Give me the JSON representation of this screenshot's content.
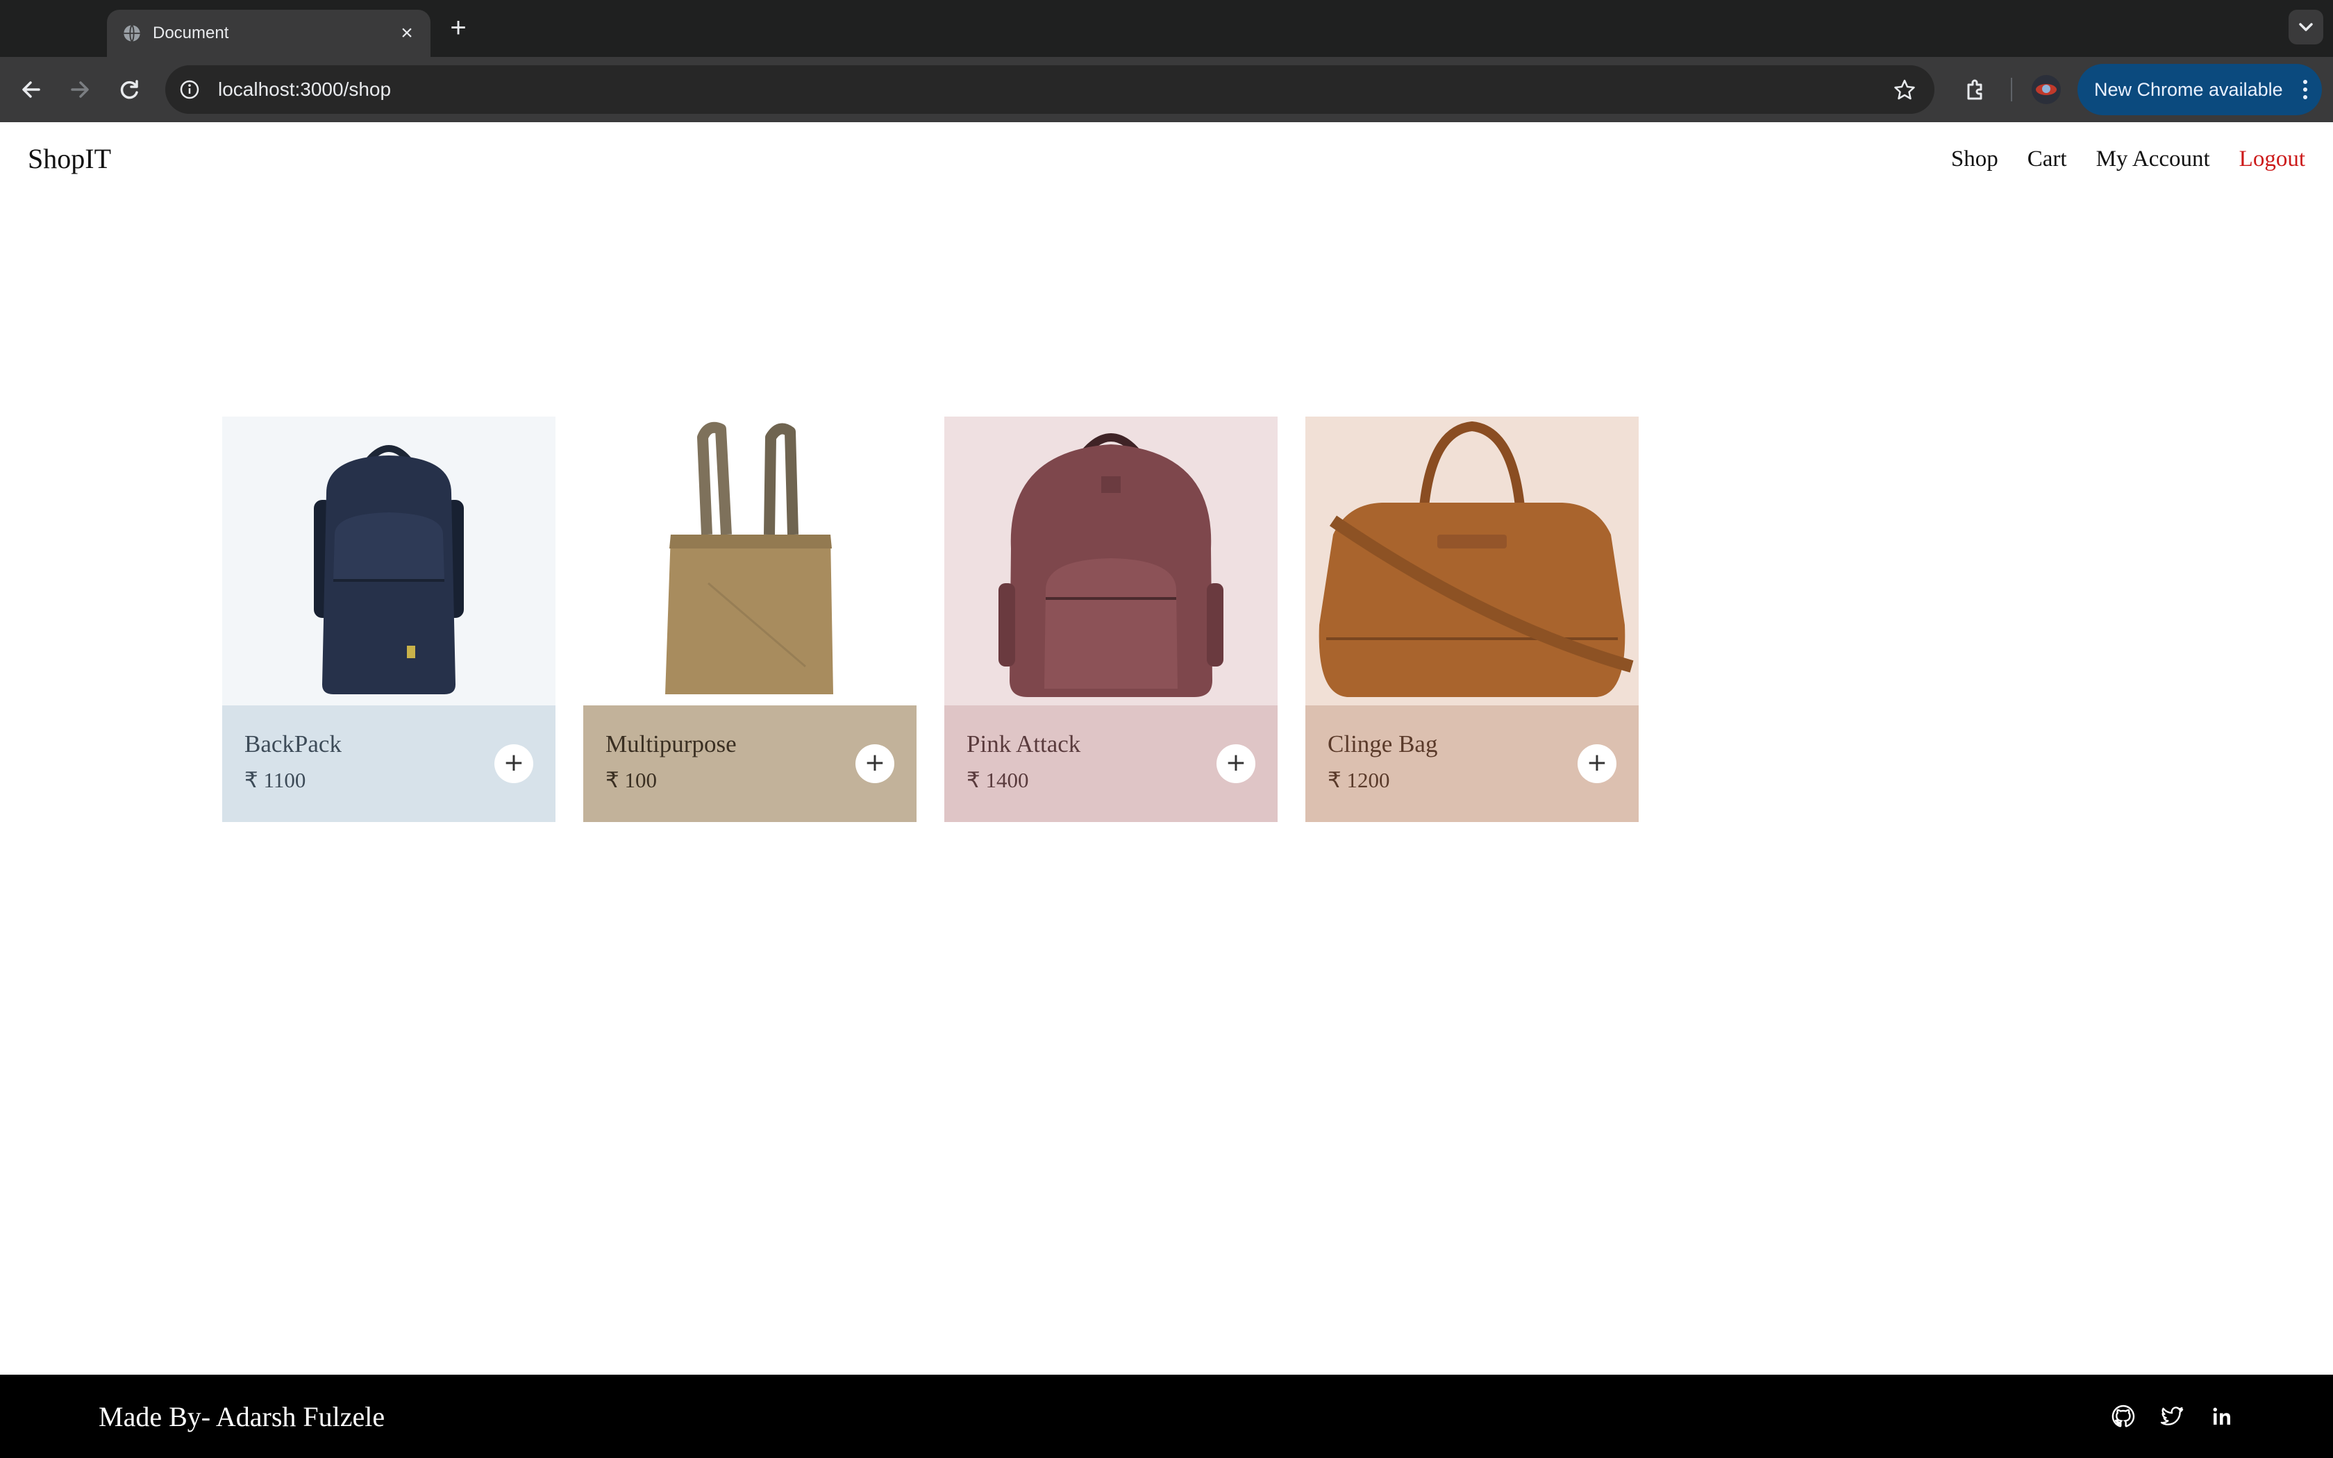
{
  "browser": {
    "tab_title": "Document",
    "url": "localhost:3000/shop",
    "update_label": "New Chrome available"
  },
  "site": {
    "brand": "ShopIT",
    "nav": [
      {
        "label": "Shop"
      },
      {
        "label": "Cart"
      },
      {
        "label": "My Account"
      },
      {
        "label": "Logout",
        "color": "#cc1a1a"
      }
    ]
  },
  "products": [
    {
      "name": "BackPack",
      "price": "₹ 1100",
      "bg": "#f3f6f9",
      "panel": "#d7e2ea",
      "text": "#3d4b58",
      "add_label": "+"
    },
    {
      "name": "Multipurpose",
      "price": "₹ 100",
      "bg": "#ffffff",
      "panel": "#c2b29a",
      "text": "#3a2f22",
      "add_label": "+"
    },
    {
      "name": "Pink Attack",
      "price": "₹ 1400",
      "bg": "#efe0e1",
      "panel": "#dfc5c6",
      "text": "#5a3b3d",
      "add_label": "+"
    },
    {
      "name": "Clinge Bag",
      "price": "₹ 1200",
      "bg": "#f1e0d6",
      "panel": "#dcc0b0",
      "text": "#5a3a2a",
      "add_label": "+"
    }
  ],
  "footer": {
    "credit": "Made By- Adarsh Fulzele",
    "icons": [
      "github-icon",
      "twitter-icon",
      "linkedin-icon"
    ]
  }
}
